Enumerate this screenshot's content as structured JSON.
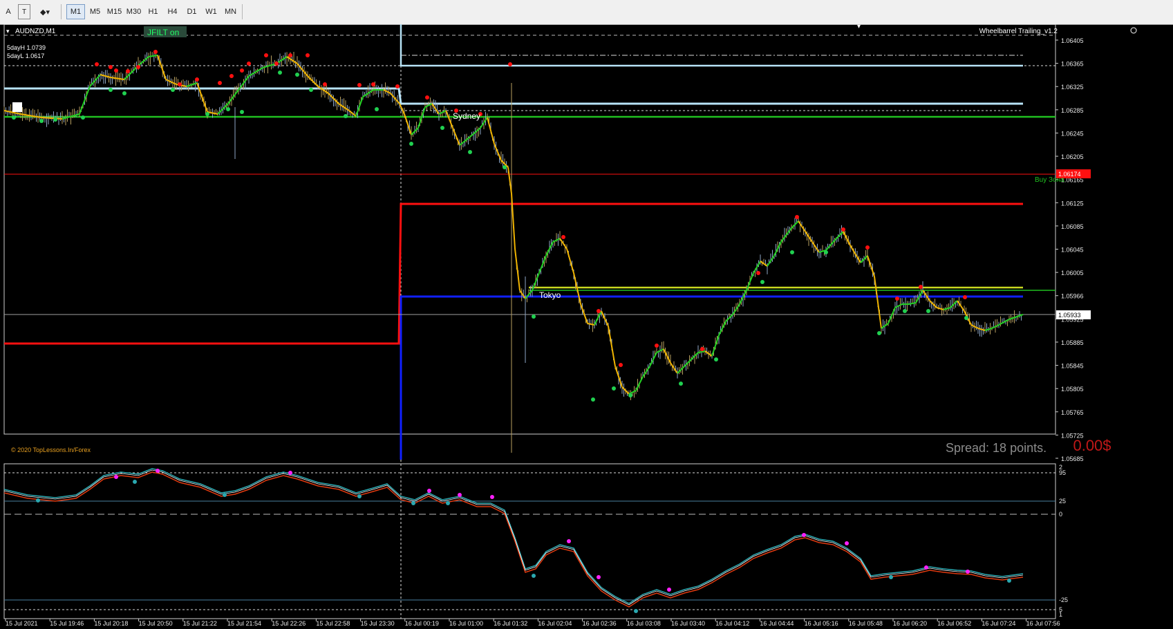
{
  "toolbar": {
    "tools": [
      "A",
      "T",
      "shapes"
    ],
    "timeframes": [
      "M1",
      "M5",
      "M15",
      "M30",
      "H1",
      "H4",
      "D1",
      "W1",
      "MN"
    ],
    "active_timeframe": "M1"
  },
  "chart": {
    "symbol": "AUDNZD,M1",
    "jfilt_label": "JFILT on",
    "five_day_high": "5dayH 1.0739",
    "five_day_low": "5dayL 1.0617",
    "indicator_name": "Wheelbarrel Trailing_v1.2",
    "copyright": "© 2020 TopLessons.In/Forex",
    "spread_text": "Spread: 18 points.",
    "profit_text": "0.00$",
    "sydney_label": "Sydney",
    "tokyo_label": "Tokyo",
    "buy_zone_label": "Buy Зона",
    "current_price": "1.05933",
    "red_price": "1.06174",
    "price_ticks": [
      "1.06405",
      "1.06365",
      "1.06325",
      "1.06285",
      "1.06245",
      "1.06205",
      "1.06165",
      "1.06125",
      "1.06085",
      "1.06045",
      "1.06005",
      "1.05966",
      "1.05925",
      "1.05885",
      "1.05845",
      "1.05805",
      "1.05765",
      "1.05725",
      "1.05685"
    ],
    "sub_ticks": [
      "2",
      "95",
      "25",
      "0",
      "-25",
      "5",
      "1"
    ],
    "time_ticks": [
      "15 Jul 2021",
      "15 Jul 19:46",
      "15 Jul 20:18",
      "15 Jul 20:50",
      "15 Jul 21:22",
      "15 Jul 21:54",
      "15 Jul 22:26",
      "15 Jul 22:58",
      "15 Jul 23:30",
      "16 Jul 00:19",
      "16 Jul 01:00",
      "16 Jul 01:32",
      "16 Jul 02:04",
      "16 Jul 02:36",
      "16 Jul 03:08",
      "16 Jul 03:40",
      "16 Jul 04:12",
      "16 Jul 04:44",
      "16 Jul 05:16",
      "16 Jul 05:48",
      "16 Jul 06:20",
      "16 Jul 06:52",
      "16 Jul 07:24",
      "16 Jul 07:56"
    ]
  },
  "colors": {
    "background": "#000000",
    "price_up_line": "#22d022",
    "price_down_line": "#f0b400",
    "red_level": "#ff1010",
    "blue_level": "#1020ff",
    "light_level": "#b8e4f8",
    "green_level": "#20c020",
    "yellow_level": "#c8d820",
    "dot_red": "#ff1010",
    "dot_green": "#20d050",
    "osc_red": "#e03a10",
    "osc_teal": "#2aa8b0",
    "osc_magenta": "#ff20ff"
  }
}
